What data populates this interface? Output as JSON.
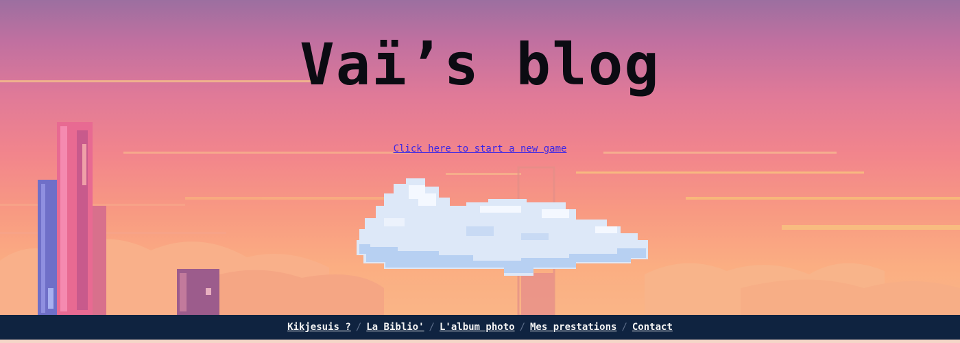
{
  "site": {
    "title": "Vaï’s blog"
  },
  "hero": {
    "start_link": "Click here to start a new game"
  },
  "nav": {
    "items": [
      {
        "label": "Kikjesuis ?"
      },
      {
        "label": "La Biblio'"
      },
      {
        "label": "L'album photo"
      },
      {
        "label": "Mes prestations"
      },
      {
        "label": "Contact"
      }
    ],
    "separator": "/"
  },
  "colors": {
    "title": "#0b0b12",
    "link": "#3b27e6",
    "navbar_bg": "#0f2340",
    "nav_text": "#f4f4f4"
  }
}
